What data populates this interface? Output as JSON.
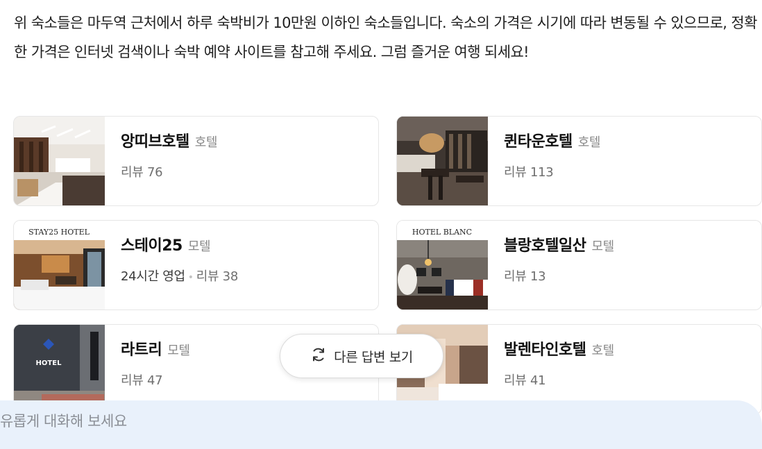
{
  "intro_text": "위 숙소들은 마두역 근처에서 하루 숙박비가 10만원 이하인 숙소들입니다. 숙소의 가격은 시기에 따라 변동될 수 있으므로, 정확한 가격은 인터넷 검색이나 숙박 예약 사이트를 참고해 주세요. 그럼 즐거운 여행 되세요!",
  "cards": [
    {
      "name": "앙띠브호텔",
      "category": "호텔",
      "review": "리뷰 76"
    },
    {
      "name": "퀸타운호텔",
      "category": "호텔",
      "review": "리뷰 113"
    },
    {
      "name": "스테이25",
      "category": "모텔",
      "hours": "24시간 영업",
      "review": "리뷰 38",
      "thumb_sign": "STAY25 HOTEL"
    },
    {
      "name": "블랑호텔일산",
      "category": "모텔",
      "review": "리뷰 13",
      "thumb_sign": "HOTEL BLANC"
    },
    {
      "name": "라트리",
      "category": "모텔",
      "review": "리뷰 47",
      "thumb_sign": "HOTEL"
    },
    {
      "name": "발렌타인호텔",
      "category": "호텔",
      "review": "리뷰 41"
    }
  ],
  "other_answer_label": "다른 답변 보기",
  "other_answer_icon": "refresh-icon",
  "chat_placeholder": "유롭게 대화해 보세요",
  "colors": {
    "chat_bg": "#e9f1fb",
    "meta": "#6f6f6f",
    "category": "#8a8a8a"
  }
}
